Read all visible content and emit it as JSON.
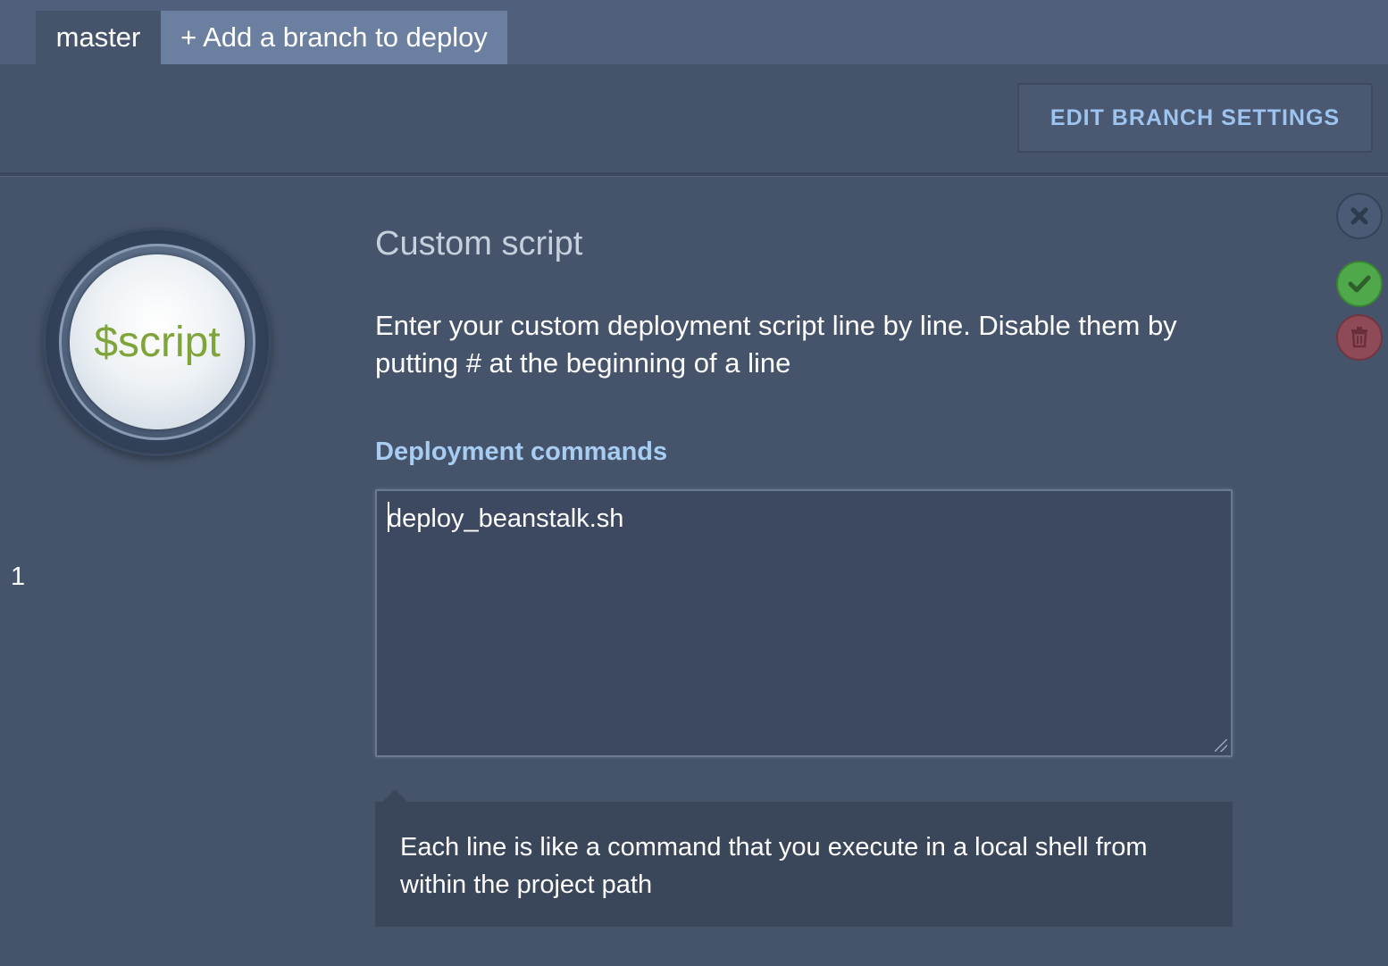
{
  "tabs": {
    "master": "master",
    "add_branch": "+ Add a branch to deploy"
  },
  "header": {
    "edit_branch_settings": "EDIT BRANCH SETTINGS"
  },
  "step": {
    "number": "1",
    "badge_text": "$script",
    "title": "Custom script",
    "description": "Enter your custom deployment script line by line. Disable them by putting # at the beginning of a line",
    "commands_label": "Deployment commands",
    "commands_value": "deploy_beanstalk.sh",
    "hint": "Each line is like a command that you execute in a local shell from within the project path"
  },
  "actions": {
    "close_icon": "close-icon",
    "confirm_icon": "check-icon",
    "delete_icon": "trash-icon"
  },
  "colors": {
    "background": "#46546b",
    "accent_label": "#a7cdf3",
    "confirm": "#4fa94a",
    "delete": "#8e4a56",
    "badge_text": "#7ea43a"
  }
}
